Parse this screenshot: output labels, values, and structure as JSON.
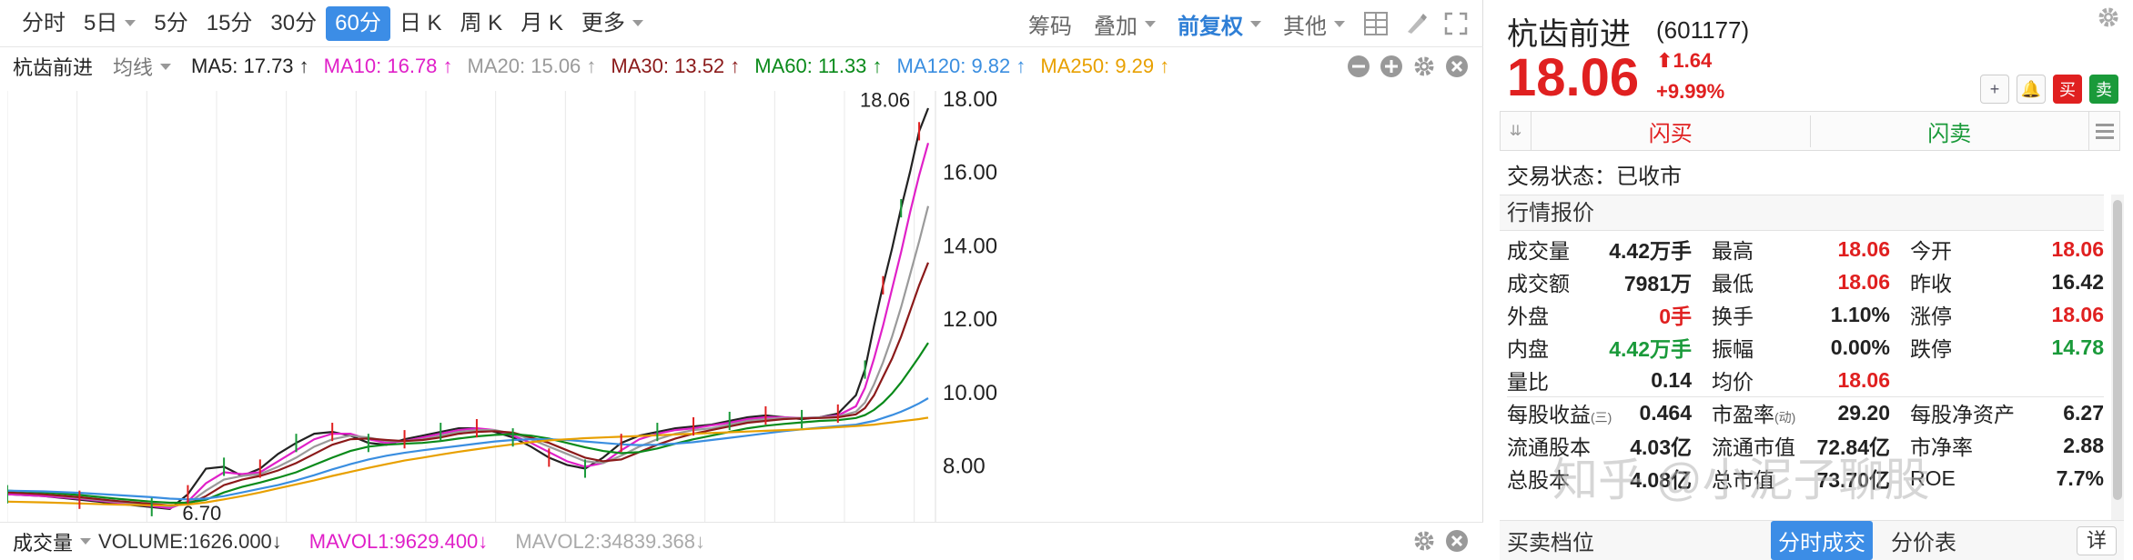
{
  "toolbar": {
    "periods": [
      {
        "label": "分时",
        "dropdown": false
      },
      {
        "label": "5日",
        "dropdown": true
      },
      {
        "label": "5分",
        "dropdown": false
      },
      {
        "label": "15分",
        "dropdown": false
      },
      {
        "label": "30分",
        "dropdown": false
      },
      {
        "label": "60分",
        "dropdown": false,
        "active": true
      },
      {
        "label": "日 K",
        "dropdown": false
      },
      {
        "label": "周 K",
        "dropdown": false
      },
      {
        "label": "月 K",
        "dropdown": false
      },
      {
        "label": "更多",
        "dropdown": true
      }
    ],
    "chips": "筹码",
    "overlay": "叠加",
    "adjust": "前复权",
    "other": "其他",
    "icons": [
      "layout-icon",
      "brush-icon",
      "fullscreen-icon"
    ]
  },
  "ma_bar": {
    "stock_name": "杭齿前进",
    "mode": "均线",
    "items": [
      {
        "label": "MA5: 17.73 ↑",
        "color": "#222222"
      },
      {
        "label": "MA10: 16.78 ↑",
        "color": "#e020c8"
      },
      {
        "label": "MA20: 15.06 ↑",
        "color": "#9a9a9a"
      },
      {
        "label": "MA30: 13.52 ↑",
        "color": "#8b1a1a"
      },
      {
        "label": "MA60: 11.33 ↑",
        "color": "#0a8a1a"
      },
      {
        "label": "MA120: 9.82 ↑",
        "color": "#3a8ee0"
      },
      {
        "label": "MA250: 9.29 ↑",
        "color": "#e8a000"
      }
    ]
  },
  "chart_data": {
    "type": "line",
    "candle_note": "60-minute K-line, price axis only",
    "yticks": [
      "18.00",
      "16.00",
      "14.00",
      "12.00",
      "10.00",
      "8.00"
    ],
    "ylim": [
      6.3,
      18.2
    ],
    "price_axis_values": [
      18,
      16,
      14,
      12,
      10,
      8
    ],
    "high_label": "18.06",
    "low_label": "6.70",
    "x": [
      0,
      40,
      80,
      120,
      160,
      180,
      200,
      220,
      240,
      260,
      280,
      300,
      320,
      340,
      360,
      380,
      400,
      420,
      440,
      460,
      480,
      500,
      520,
      540,
      560,
      580,
      600,
      620,
      640,
      660,
      680,
      700,
      720,
      740,
      760,
      780,
      800,
      820,
      840,
      860,
      880,
      900,
      920,
      940,
      950,
      960,
      970,
      980,
      990,
      1000,
      1010,
      1020
    ],
    "series": [
      {
        "name": "MA5",
        "color": "#222222",
        "values": [
          7.2,
          7.15,
          7.05,
          6.95,
          6.85,
          6.8,
          7.2,
          7.9,
          7.95,
          7.7,
          7.9,
          8.3,
          8.6,
          8.85,
          8.9,
          8.8,
          8.6,
          8.55,
          8.7,
          8.8,
          8.9,
          9.0,
          9.0,
          8.9,
          8.75,
          8.5,
          8.2,
          8.0,
          7.9,
          8.2,
          8.6,
          8.8,
          8.9,
          9.0,
          9.05,
          9.1,
          9.2,
          9.3,
          9.35,
          9.3,
          9.25,
          9.3,
          9.4,
          9.9,
          10.6,
          11.8,
          12.9,
          13.9,
          15.0,
          16.0,
          17.1,
          17.73
        ]
      },
      {
        "name": "MA10",
        "color": "#e020c8",
        "values": [
          7.2,
          7.15,
          7.08,
          6.98,
          6.88,
          6.82,
          7.0,
          7.5,
          7.8,
          7.75,
          7.8,
          8.1,
          8.4,
          8.7,
          8.85,
          8.85,
          8.7,
          8.6,
          8.65,
          8.75,
          8.85,
          8.95,
          9.0,
          8.95,
          8.8,
          8.6,
          8.35,
          8.1,
          7.95,
          8.05,
          8.4,
          8.7,
          8.85,
          8.95,
          9.0,
          9.08,
          9.15,
          9.25,
          9.3,
          9.3,
          9.28,
          9.3,
          9.35,
          9.6,
          10.1,
          10.9,
          11.8,
          12.8,
          13.8,
          14.9,
          15.9,
          16.78
        ]
      },
      {
        "name": "MA20",
        "color": "#9a9a9a",
        "values": [
          7.25,
          7.2,
          7.1,
          7.0,
          6.92,
          6.87,
          6.95,
          7.3,
          7.6,
          7.7,
          7.75,
          7.95,
          8.2,
          8.5,
          8.7,
          8.8,
          8.75,
          8.65,
          8.65,
          8.7,
          8.8,
          8.9,
          8.95,
          8.95,
          8.85,
          8.7,
          8.5,
          8.3,
          8.1,
          8.05,
          8.25,
          8.5,
          8.7,
          8.85,
          8.95,
          9.0,
          9.1,
          9.2,
          9.25,
          9.28,
          9.28,
          9.3,
          9.32,
          9.45,
          9.7,
          10.2,
          10.8,
          11.5,
          12.3,
          13.2,
          14.1,
          15.06
        ]
      },
      {
        "name": "MA30",
        "color": "#8b1a1a",
        "values": [
          7.25,
          7.2,
          7.12,
          7.02,
          6.94,
          6.9,
          6.93,
          7.15,
          7.45,
          7.6,
          7.7,
          7.85,
          8.05,
          8.3,
          8.55,
          8.7,
          8.72,
          8.68,
          8.65,
          8.68,
          8.75,
          8.85,
          8.9,
          8.92,
          8.88,
          8.75,
          8.6,
          8.4,
          8.2,
          8.1,
          8.15,
          8.35,
          8.55,
          8.72,
          8.85,
          8.95,
          9.05,
          9.15,
          9.2,
          9.25,
          9.27,
          9.28,
          9.3,
          9.38,
          9.55,
          9.9,
          10.4,
          10.9,
          11.5,
          12.2,
          12.9,
          13.52
        ]
      },
      {
        "name": "MA60",
        "color": "#0a8a1a",
        "values": [
          7.3,
          7.25,
          7.18,
          7.08,
          7.0,
          6.97,
          6.97,
          7.05,
          7.25,
          7.4,
          7.52,
          7.65,
          7.8,
          8.0,
          8.2,
          8.38,
          8.5,
          8.55,
          8.58,
          8.6,
          8.65,
          8.72,
          8.78,
          8.82,
          8.84,
          8.8,
          8.72,
          8.6,
          8.48,
          8.38,
          8.32,
          8.35,
          8.45,
          8.58,
          8.7,
          8.8,
          8.9,
          9.0,
          9.07,
          9.12,
          9.16,
          9.2,
          9.22,
          9.28,
          9.36,
          9.5,
          9.7,
          9.95,
          10.25,
          10.6,
          10.95,
          11.33
        ]
      },
      {
        "name": "MA120",
        "color": "#3a8ee0",
        "values": [
          7.3,
          7.28,
          7.24,
          7.18,
          7.12,
          7.08,
          7.06,
          7.08,
          7.15,
          7.25,
          7.35,
          7.45,
          7.58,
          7.72,
          7.88,
          8.02,
          8.15,
          8.25,
          8.33,
          8.4,
          8.46,
          8.52,
          8.58,
          8.64,
          8.68,
          8.7,
          8.7,
          8.68,
          8.64,
          8.6,
          8.56,
          8.54,
          8.55,
          8.58,
          8.62,
          8.68,
          8.74,
          8.8,
          8.86,
          8.92,
          8.97,
          9.02,
          9.06,
          9.1,
          9.15,
          9.2,
          9.28,
          9.36,
          9.45,
          9.56,
          9.68,
          9.82
        ]
      },
      {
        "name": "MA250",
        "color": "#e8a000",
        "values": [
          7.0,
          6.98,
          6.95,
          6.92,
          6.9,
          6.9,
          6.92,
          6.98,
          7.06,
          7.15,
          7.25,
          7.36,
          7.47,
          7.58,
          7.7,
          7.81,
          7.92,
          8.02,
          8.12,
          8.2,
          8.28,
          8.36,
          8.43,
          8.5,
          8.56,
          8.62,
          8.67,
          8.7,
          8.73,
          8.75,
          8.77,
          8.79,
          8.81,
          8.83,
          8.85,
          8.87,
          8.89,
          8.91,
          8.93,
          8.95,
          8.97,
          9.0,
          9.03,
          9.06,
          9.08,
          9.1,
          9.13,
          9.16,
          9.19,
          9.22,
          9.25,
          9.29
        ]
      }
    ],
    "grid": true
  },
  "vol_bar": {
    "label": "成交量",
    "volume": "VOLUME:1626.000↓",
    "mavol1": "MAVOL1:9629.400↓",
    "mavol2": "MAVOL2:34839.368↓"
  },
  "quote": {
    "name": "杭齿前进",
    "code": "(601177)",
    "price": "18.06",
    "change": "1.64",
    "pct": "+9.99%",
    "buttons": {
      "add": "+",
      "bell": "🔔",
      "buy": "买",
      "sell": "卖"
    },
    "flash_buy": "闪买",
    "flash_sell": "闪卖",
    "trade_status": "交易状态：已收市",
    "section_title": "行情报价",
    "rows": [
      [
        {
          "k": "成交量",
          "v": "4.42万手",
          "c": ""
        },
        {
          "k": "最高",
          "v": "18.06",
          "c": "red"
        },
        {
          "k": "今开",
          "v": "18.06",
          "c": "red"
        }
      ],
      [
        {
          "k": "成交额",
          "v": "7981万",
          "c": ""
        },
        {
          "k": "最低",
          "v": "18.06",
          "c": "red"
        },
        {
          "k": "昨收",
          "v": "16.42",
          "c": ""
        }
      ],
      [
        {
          "k": "外盘",
          "v": "0手",
          "c": "red"
        },
        {
          "k": "换手",
          "v": "1.10%",
          "c": ""
        },
        {
          "k": "涨停",
          "v": "18.06",
          "c": "red"
        }
      ],
      [
        {
          "k": "内盘",
          "v": "4.42万手",
          "c": "green"
        },
        {
          "k": "振幅",
          "v": "0.00%",
          "c": ""
        },
        {
          "k": "跌停",
          "v": "14.78",
          "c": "green"
        }
      ],
      [
        {
          "k": "量比",
          "v": "0.14",
          "c": ""
        },
        {
          "k": "均价",
          "v": "18.06",
          "c": "red"
        },
        {
          "k": "",
          "v": "",
          "c": ""
        }
      ],
      [
        {
          "k": "每股收益",
          "sub": "(三)",
          "v": "0.464",
          "c": ""
        },
        {
          "k": "市盈率",
          "sub": "(动)",
          "v": "29.20",
          "c": ""
        },
        {
          "k": "每股净资产",
          "v": "6.27",
          "c": ""
        }
      ],
      [
        {
          "k": "流通股本",
          "v": "4.03亿",
          "c": ""
        },
        {
          "k": "流通市值",
          "v": "72.84亿",
          "c": ""
        },
        {
          "k": "市净率",
          "v": "2.88",
          "c": ""
        }
      ],
      [
        {
          "k": "总股本",
          "v": "4.08亿",
          "c": ""
        },
        {
          "k": "总市值",
          "v": "73.70亿",
          "c": ""
        },
        {
          "k": "ROE",
          "v": "7.7%",
          "c": ""
        }
      ]
    ],
    "watermark": "知乎 @小泥子聊股",
    "bottom": {
      "title": "买卖档位",
      "tab_active": "分时成交",
      "tab2": "分价表",
      "detail": "详"
    }
  }
}
